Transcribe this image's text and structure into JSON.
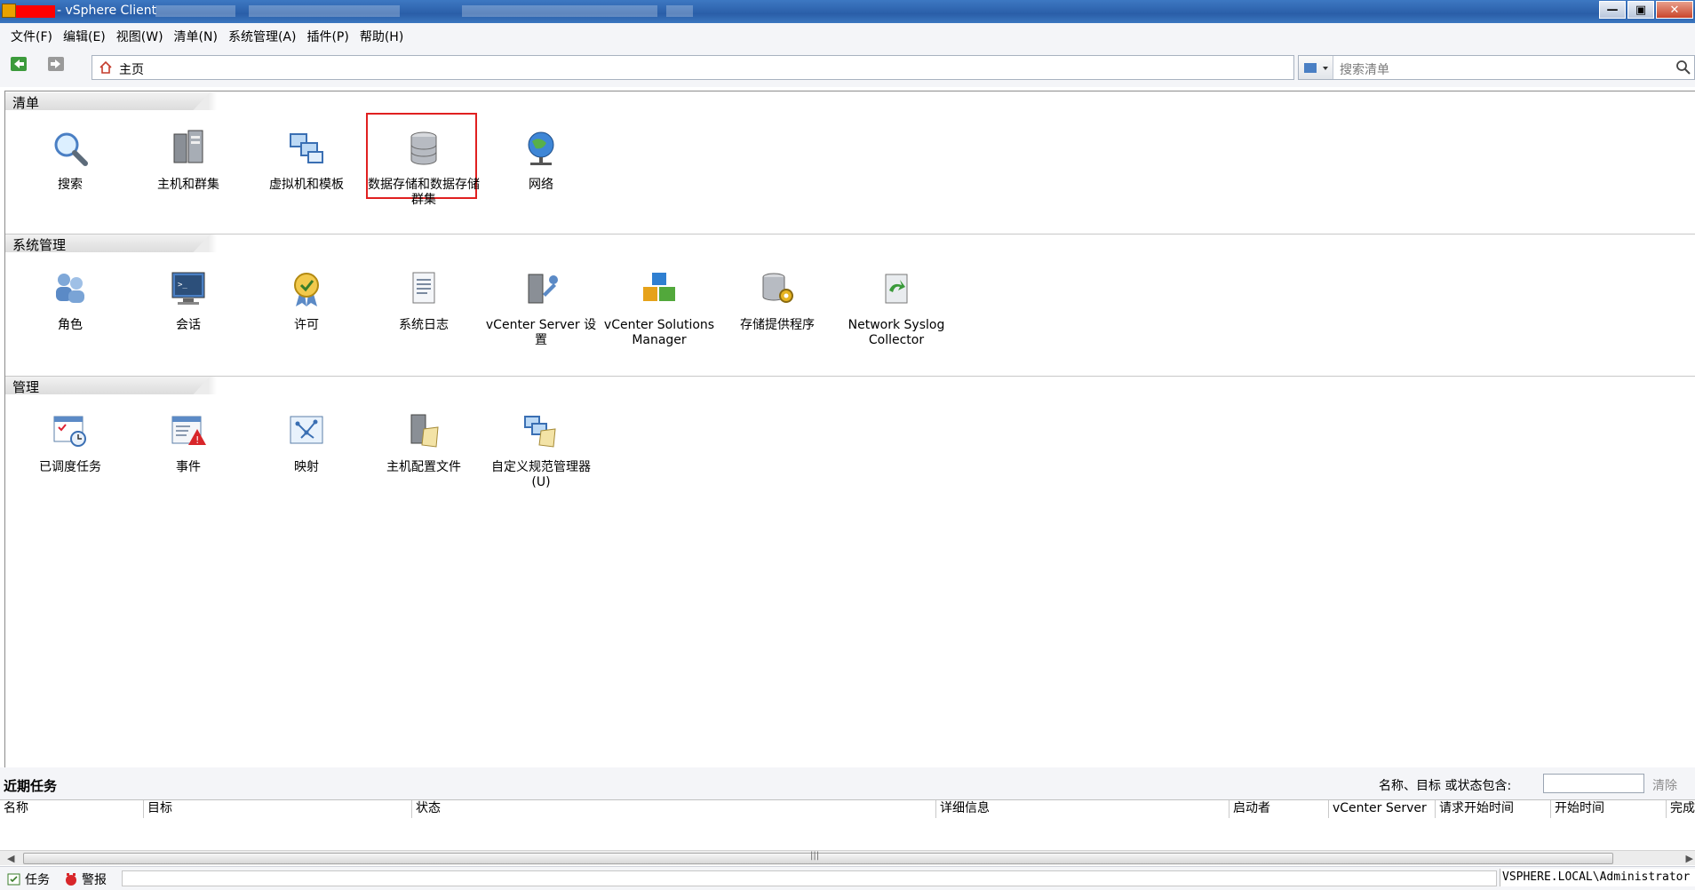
{
  "window": {
    "title": "- vSphere Client"
  },
  "menu": [
    "文件(F)",
    "编辑(E)",
    "视图(W)",
    "清单(N)",
    "系统管理(A)",
    "插件(P)",
    "帮助(H)"
  ],
  "address": {
    "text": "主页"
  },
  "search": {
    "placeholder": "搜索清单"
  },
  "sections": {
    "inventory": {
      "title": "清单",
      "items": [
        "搜索",
        "主机和群集",
        "虚拟机和模板",
        "数据存储和数据存储群集",
        "网络"
      ]
    },
    "administration": {
      "title": "系统管理",
      "items": [
        "角色",
        "会话",
        "许可",
        "系统日志",
        "vCenter Server 设置",
        "vCenter Solutions Manager",
        "存储提供程序",
        "Network Syslog Collector"
      ]
    },
    "management": {
      "title": "管理",
      "items": [
        "已调度任务",
        "事件",
        "映射",
        "主机配置文件",
        "自定义规范管理器(U)"
      ]
    }
  },
  "recent_tasks": {
    "title": "近期任务",
    "filter_label": "名称、目标 或状态包含:",
    "clear_label": "清除",
    "columns": [
      "名称",
      "目标",
      "状态",
      "详细信息",
      "启动者",
      "vCenter Server",
      "请求开始时间",
      "开始时间",
      "完成"
    ]
  },
  "statusbar": {
    "tasks": "任务",
    "alarms": "警报",
    "user": "VSPHERE.LOCAL\\Administrator"
  },
  "colors": {
    "highlight": "#e02020",
    "titlebar": "#2a5ea8"
  }
}
